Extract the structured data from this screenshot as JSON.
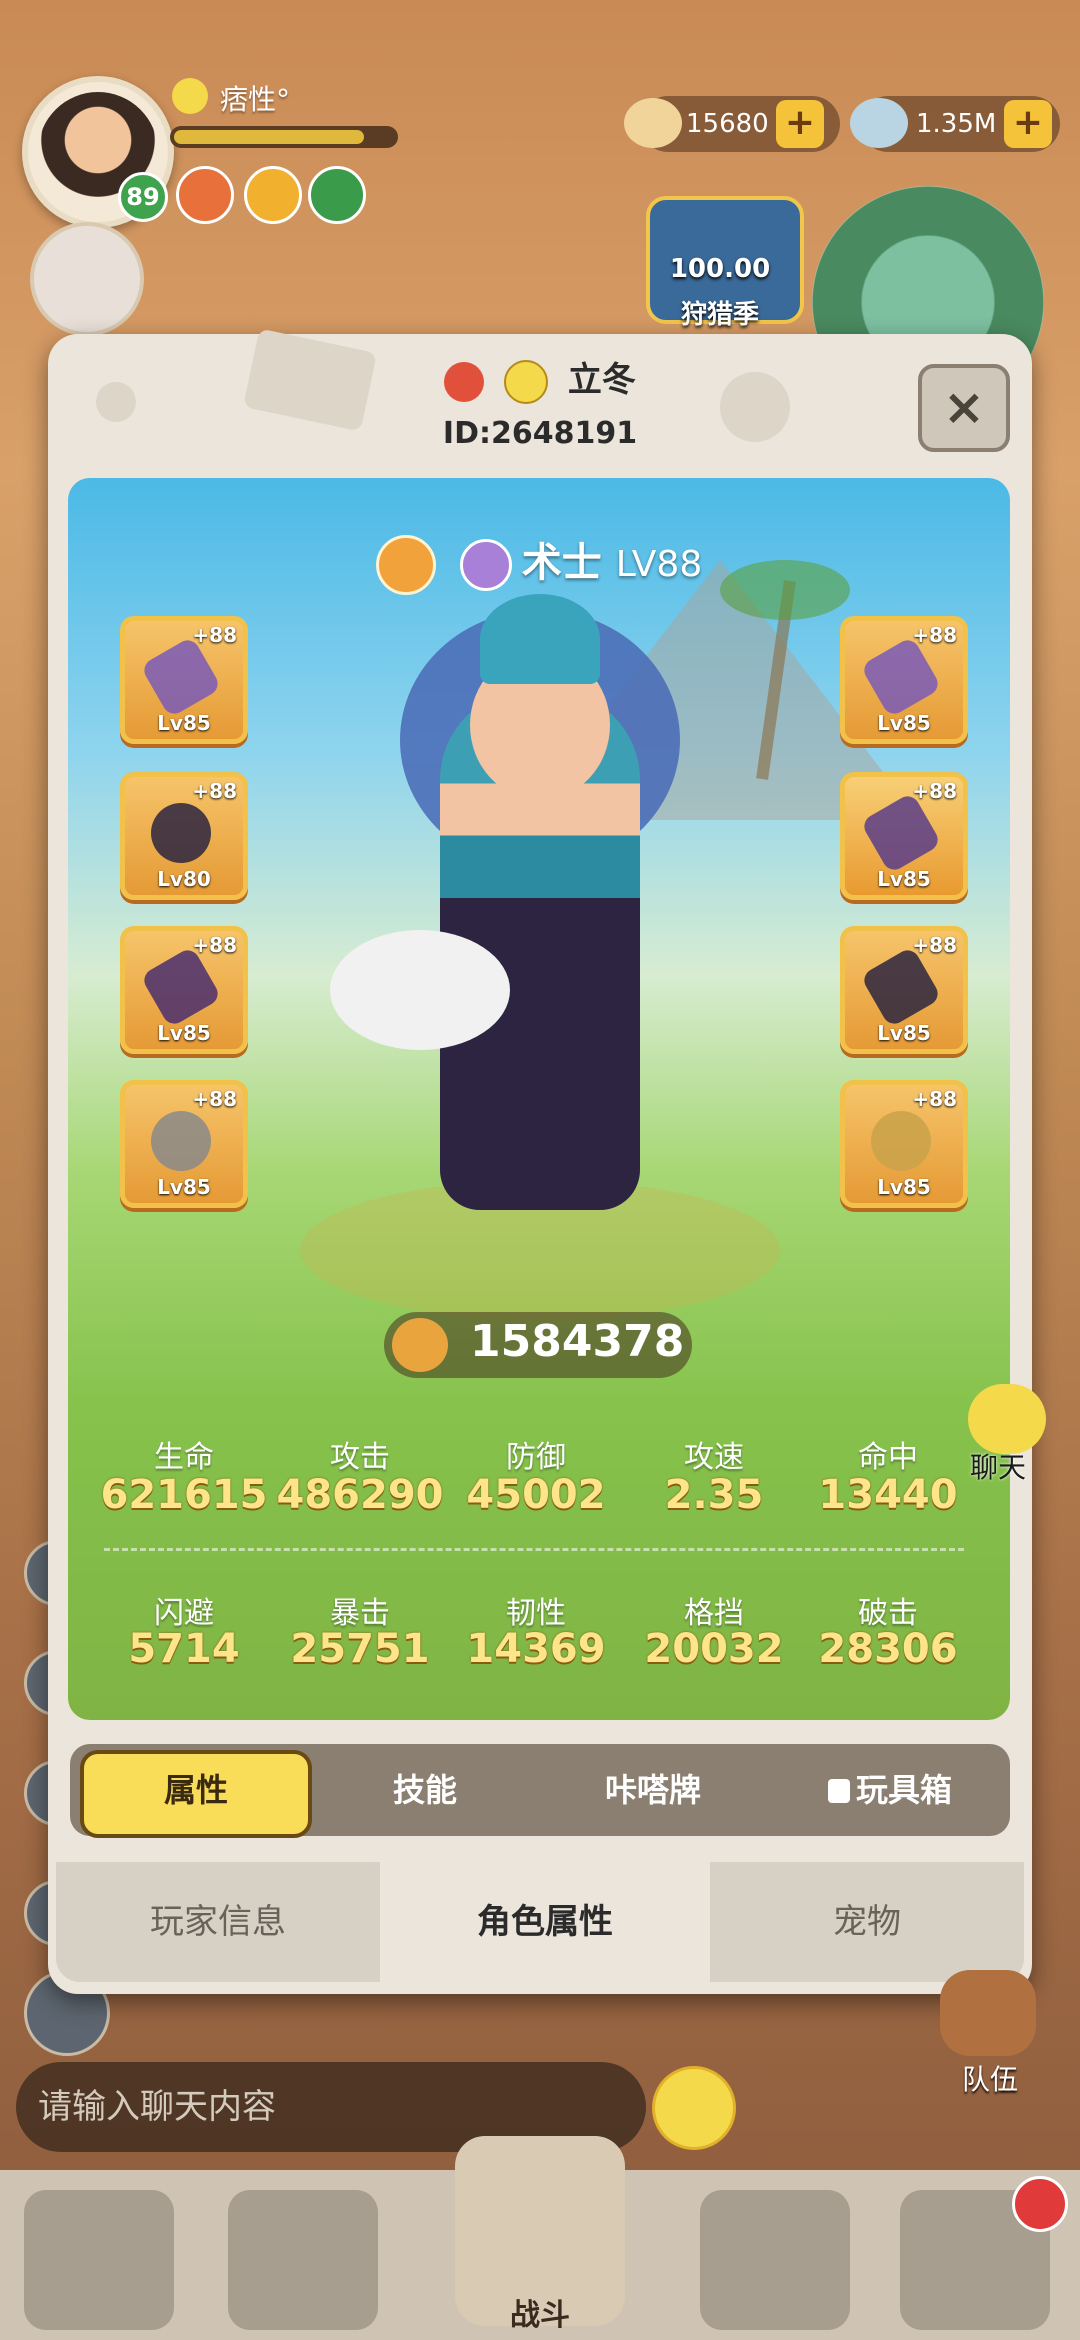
{
  "hud": {
    "player_level": "89",
    "player_name": "痞性°",
    "gold": "15680",
    "gems": "1.35M",
    "season_progress": "100.00",
    "season_label": "狩猎季",
    "plus": "+"
  },
  "dialog": {
    "name": "立冬",
    "id": "ID:2648191",
    "close_label": "×",
    "class_name": "术士",
    "class_level": "LV88",
    "power": "1584378"
  },
  "equipment": {
    "left": [
      {
        "plus": "+88",
        "level": "Lv85"
      },
      {
        "plus": "+88",
        "level": "Lv80"
      },
      {
        "plus": "+88",
        "level": "Lv85"
      },
      {
        "plus": "+88",
        "level": "Lv85"
      }
    ],
    "right": [
      {
        "plus": "+88",
        "level": "Lv85"
      },
      {
        "plus": "+88",
        "level": "Lv85"
      },
      {
        "plus": "+88",
        "level": "Lv85"
      },
      {
        "plus": "+88",
        "level": "Lv85"
      }
    ]
  },
  "stats": {
    "row1": [
      {
        "label": "生命",
        "value": "621615"
      },
      {
        "label": "攻击",
        "value": "486290"
      },
      {
        "label": "防御",
        "value": "45002"
      },
      {
        "label": "攻速",
        "value": "2.35"
      },
      {
        "label": "命中",
        "value": "13440"
      }
    ],
    "row2": [
      {
        "label": "闪避",
        "value": "5714"
      },
      {
        "label": "暴击",
        "value": "25751"
      },
      {
        "label": "韧性",
        "value": "14369"
      },
      {
        "label": "格挡",
        "value": "20032"
      },
      {
        "label": "破击",
        "value": "28306"
      }
    ]
  },
  "subtabs": [
    "属性",
    "技能",
    "咔嗒牌",
    "玩具箱"
  ],
  "bottom_tabs": [
    "玩家信息",
    "角色属性",
    "宠物"
  ],
  "chat": {
    "placeholder": "请输入聊天内容",
    "chat_label": "聊天",
    "team_label": "队伍"
  },
  "nav": {
    "battle_label": "战斗"
  },
  "colors": {
    "accent_yellow": "#f9dc58",
    "stat_value": "#ffe58a",
    "dialog_bg": "#ebe5db"
  }
}
